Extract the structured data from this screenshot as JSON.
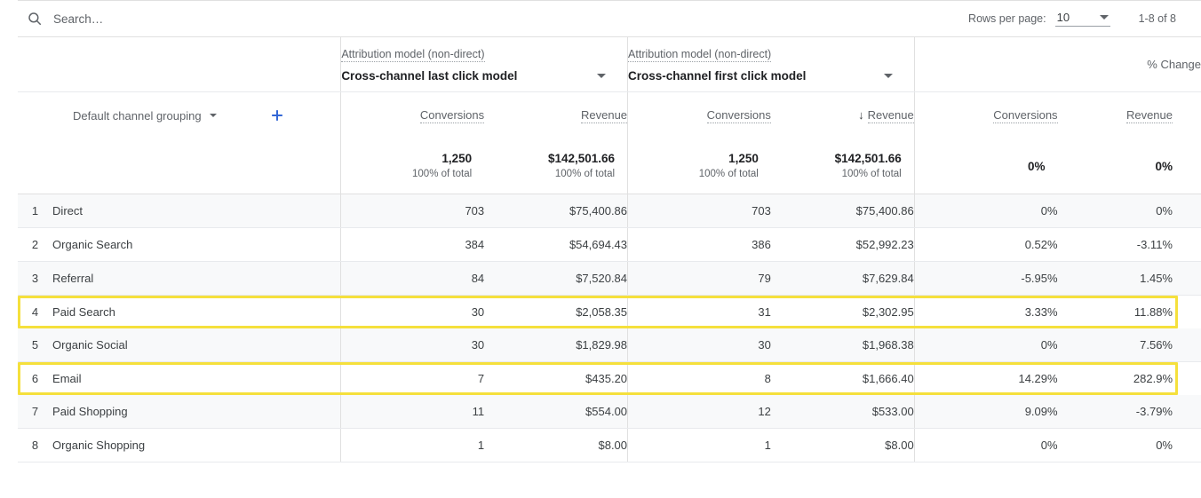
{
  "search": {
    "placeholder": "Search…",
    "value": "",
    "icon": "search-icon"
  },
  "pagination": {
    "rows_per_page_label": "Rows per page:",
    "rows_per_page_value": "10",
    "range_label": "1-8 of 8"
  },
  "column_groups": [
    {
      "attribution_label": "Attribution model (non-direct)",
      "model_value": "Cross-channel last click model"
    },
    {
      "attribution_label": "Attribution model (non-direct)",
      "model_value": "Cross-channel first click model"
    }
  ],
  "change_group": {
    "title": "% Change"
  },
  "dimension": {
    "label": "Default channel grouping",
    "add_button": "+"
  },
  "metric_headers": {
    "g1_conversions": "Conversions",
    "g1_revenue": "Revenue",
    "g2_conversions": "Conversions",
    "g2_revenue": "Revenue",
    "g2_revenue_sort": "↓",
    "chg_conversions": "Conversions",
    "chg_revenue": "Revenue"
  },
  "totals": {
    "g1_conversions": "1,250",
    "g1_conversions_sub": "100% of total",
    "g1_revenue": "$142,501.66",
    "g1_revenue_sub": "100% of total",
    "g2_conversions": "1,250",
    "g2_conversions_sub": "100% of total",
    "g2_revenue": "$142,501.66",
    "g2_revenue_sub": "100% of total",
    "chg_conversions": "0%",
    "chg_revenue": "0%"
  },
  "rows": [
    {
      "rank": "1",
      "channel": "Direct",
      "g1_conversions": "703",
      "g1_revenue": "$75,400.86",
      "g2_conversions": "703",
      "g2_revenue": "$75,400.86",
      "chg_conversions": "0%",
      "chg_revenue": "0%",
      "highlighted": false,
      "shaded": true
    },
    {
      "rank": "2",
      "channel": "Organic Search",
      "g1_conversions": "384",
      "g1_revenue": "$54,694.43",
      "g2_conversions": "386",
      "g2_revenue": "$52,992.23",
      "chg_conversions": "0.52%",
      "chg_revenue": "-3.11%",
      "highlighted": false,
      "shaded": false
    },
    {
      "rank": "3",
      "channel": "Referral",
      "g1_conversions": "84",
      "g1_revenue": "$7,520.84",
      "g2_conversions": "79",
      "g2_revenue": "$7,629.84",
      "chg_conversions": "-5.95%",
      "chg_revenue": "1.45%",
      "highlighted": false,
      "shaded": true
    },
    {
      "rank": "4",
      "channel": "Paid Search",
      "g1_conversions": "30",
      "g1_revenue": "$2,058.35",
      "g2_conversions": "31",
      "g2_revenue": "$2,302.95",
      "chg_conversions": "3.33%",
      "chg_revenue": "11.88%",
      "highlighted": true,
      "shaded": false
    },
    {
      "rank": "5",
      "channel": "Organic Social",
      "g1_conversions": "30",
      "g1_revenue": "$1,829.98",
      "g2_conversions": "30",
      "g2_revenue": "$1,968.38",
      "chg_conversions": "0%",
      "chg_revenue": "7.56%",
      "highlighted": false,
      "shaded": true
    },
    {
      "rank": "6",
      "channel": "Email",
      "g1_conversions": "7",
      "g1_revenue": "$435.20",
      "g2_conversions": "8",
      "g2_revenue": "$1,666.40",
      "chg_conversions": "14.29%",
      "chg_revenue": "282.9%",
      "highlighted": true,
      "shaded": false
    },
    {
      "rank": "7",
      "channel": "Paid Shopping",
      "g1_conversions": "11",
      "g1_revenue": "$554.00",
      "g2_conversions": "12",
      "g2_revenue": "$533.00",
      "chg_conversions": "9.09%",
      "chg_revenue": "-3.79%",
      "highlighted": false,
      "shaded": true
    },
    {
      "rank": "8",
      "channel": "Organic Shopping",
      "g1_conversions": "1",
      "g1_revenue": "$8.00",
      "g2_conversions": "1",
      "g2_revenue": "$8.00",
      "chg_conversions": "0%",
      "chg_revenue": "0%",
      "highlighted": false,
      "shaded": false
    }
  ],
  "colors": {
    "highlight": "#F5E03C",
    "accent": "#3367D6",
    "row_shade": "#F8F9FA",
    "text": "#3C4043",
    "muted": "#5F6368"
  }
}
